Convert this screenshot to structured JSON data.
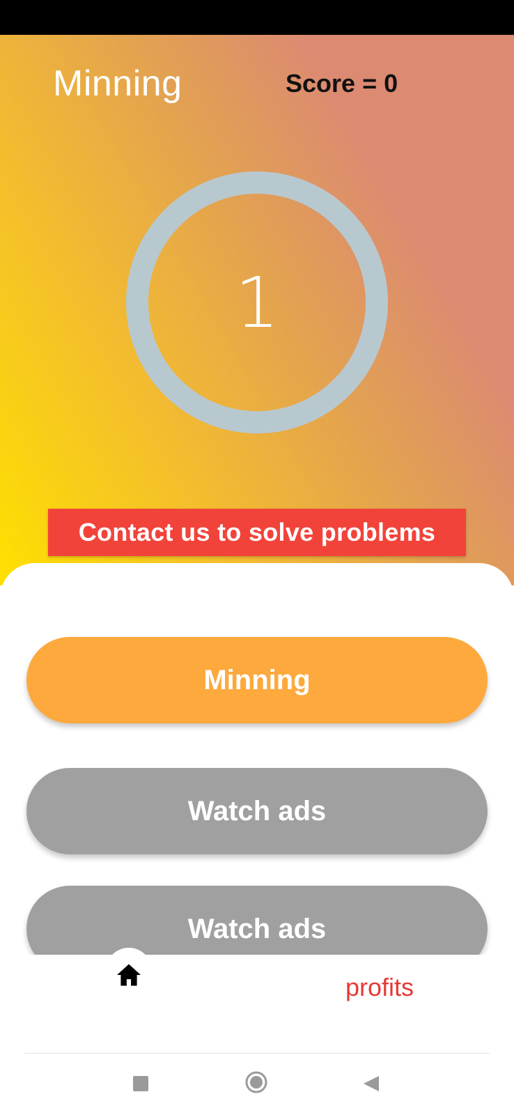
{
  "header": {
    "title": "Minning",
    "score_label": "Score",
    "score_separator": "=",
    "score_value": "0"
  },
  "counter": {
    "value": "1"
  },
  "contact_button": {
    "label": "Contact us to solve problems"
  },
  "actions": {
    "mining_label": "Minning",
    "watch_ads_1_label": "Watch ads",
    "watch_ads_2_label": "Watch ads"
  },
  "bottom_nav": {
    "home_icon": "home-icon",
    "profits_label": "profits"
  },
  "system_nav": {
    "recent_icon": "square-icon",
    "home_icon": "circle-icon",
    "back_icon": "triangle-back-icon"
  },
  "colors": {
    "gradient_start": "#ffe000",
    "gradient_end": "#dc8a72",
    "ring": "#b8c8cf",
    "contact_button": "#f2433a",
    "mining_button": "#fda93d",
    "ads_button": "#a0a0a0",
    "profits_text": "#e53935"
  }
}
